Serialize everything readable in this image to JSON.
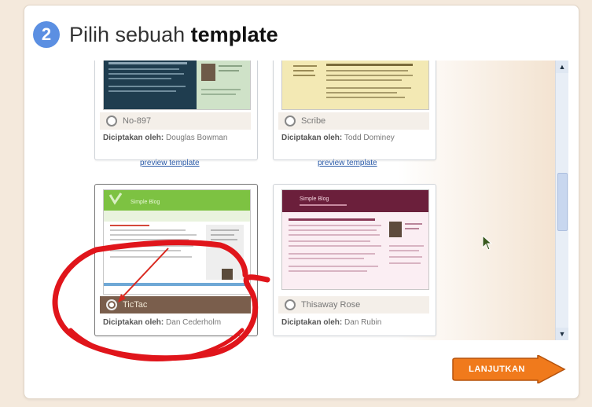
{
  "step": {
    "number": "2",
    "title_prefix": "Pilih sebuah ",
    "title_bold": "template"
  },
  "templates": [
    {
      "name": "No-897",
      "creator_label": "Diciptakan oleh:",
      "creator": "Douglas Bowman",
      "preview": "preview template",
      "selected": false
    },
    {
      "name": "Scribe",
      "creator_label": "Diciptakan oleh:",
      "creator": "Todd Dominey",
      "preview": "preview template",
      "selected": false
    },
    {
      "name": "TicTac",
      "creator_label": "Diciptakan oleh:",
      "creator": "Dan Cederholm",
      "preview": "",
      "selected": true,
      "thumb_title": "Simple Blog"
    },
    {
      "name": "Thisaway Rose",
      "creator_label": "Diciptakan oleh:",
      "creator": "Dan Rubin",
      "preview": "",
      "selected": false,
      "thumb_title": "Simple Blog"
    }
  ],
  "next_button": "LANJUTKAN",
  "colors": {
    "step_badge": "#5b8fe2",
    "next_orange": "#f07a1c",
    "annotation_red": "#e0151b",
    "selected_bar": "#7a5e4c"
  },
  "icons": {
    "scroll_up": "chevron-up-icon",
    "scroll_down": "chevron-down-icon",
    "arrow": "arrow-right-icon",
    "cursor": "mouse-pointer-icon"
  }
}
